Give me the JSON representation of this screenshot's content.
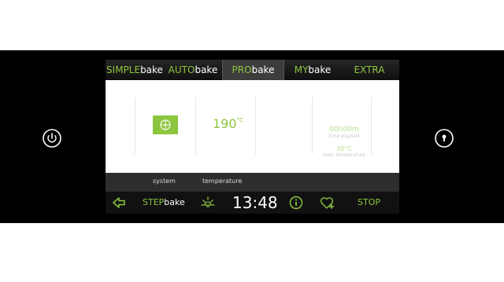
{
  "tabs": [
    {
      "pre": "SIMPLE",
      "post": "bake",
      "active": false
    },
    {
      "pre": "AUTO",
      "post": "bake",
      "active": false
    },
    {
      "pre": "PRO",
      "post": "bake",
      "active": true
    },
    {
      "pre": "MY",
      "post": "bake",
      "active": false
    },
    {
      "pre": "EXTRA",
      "post": "",
      "active": false
    }
  ],
  "panel": {
    "temperature": "190",
    "temperature_unit": "°C",
    "timer_value": "00h00m",
    "timer_label": "time elapsed",
    "oven_temp": "30°C",
    "oven_label": "oven temperature"
  },
  "labels": {
    "system": "system",
    "temperature": "temperature"
  },
  "bottom": {
    "step_pre": "STEP",
    "step_post": "bake",
    "time": "13:48",
    "stop": "STOP"
  },
  "colors": {
    "accent": "#8cc63f",
    "bezel": "#000000",
    "bar": "#111111"
  },
  "icons": [
    "power-icon",
    "key-icon",
    "back-arrow-icon",
    "light-icon",
    "info-icon",
    "favorite-add-icon",
    "fan-icon"
  ]
}
